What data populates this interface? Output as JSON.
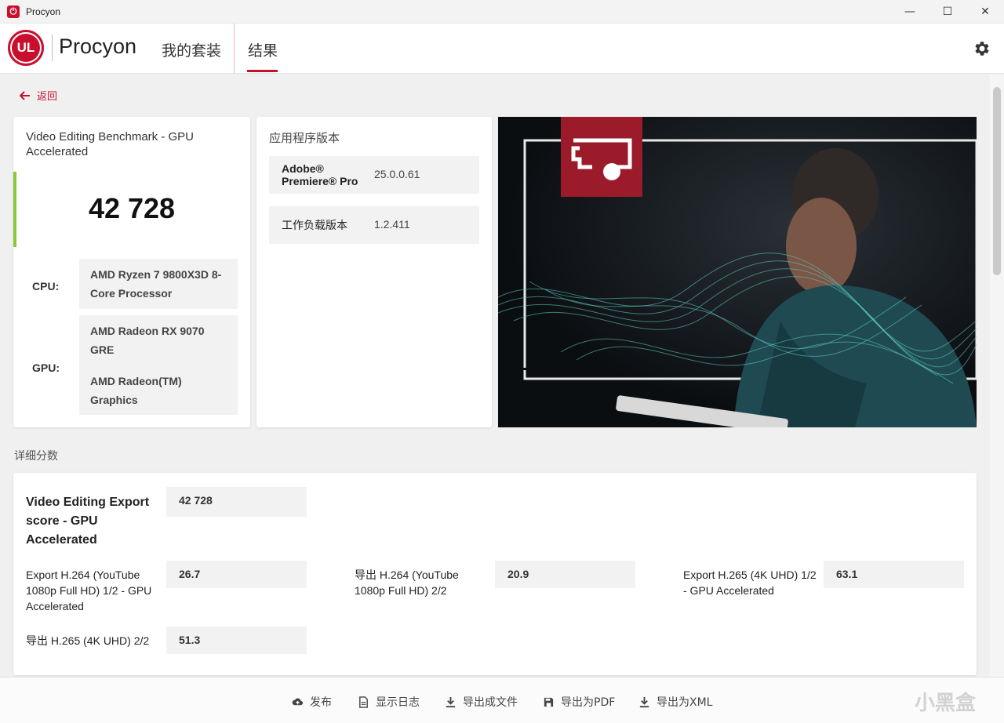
{
  "window": {
    "title": "Procyon",
    "minimize": "—",
    "maximize": "☐",
    "close": "✕"
  },
  "header": {
    "logo_text": "UL",
    "brand": "Procyon",
    "tabs": [
      {
        "label": "我的套装"
      },
      {
        "label": "结果"
      }
    ],
    "active_tab": "结果"
  },
  "nav": {
    "back_label": "返回"
  },
  "summary": {
    "benchmark_title": "Video Editing Benchmark - GPU Accelerated",
    "score": "42 728",
    "cpu_label": "CPU:",
    "cpu_value": "AMD Ryzen 7 9800X3D 8-Core Processor",
    "gpu_label": "GPU:",
    "gpu_values": [
      "AMD Radeon RX 9070 GRE",
      "AMD Radeon(TM) Graphics"
    ],
    "accent_color": "#8cc63f"
  },
  "versions": {
    "title": "应用程序版本",
    "rows": [
      {
        "key": "Adobe® Premiere® Pro",
        "value": "25.0.0.61"
      },
      {
        "key": "工作负载版本",
        "value": "1.2.411"
      }
    ]
  },
  "details": {
    "section_title": "详细分数",
    "main": {
      "label": "Video Editing Export score - GPU Accelerated",
      "value": "42 728"
    },
    "items": [
      {
        "label": "Export H.264 (YouTube 1080p Full HD) 1/2 - GPU Accelerated",
        "value": "26.7"
      },
      {
        "label": "导出 H.264 (YouTube 1080p Full HD) 2/2",
        "value": "20.9"
      },
      {
        "label": "Export H.265 (4K UHD) 1/2 - GPU Accelerated",
        "value": "63.1"
      },
      {
        "label": "导出 H.265 (4K UHD) 2/2",
        "value": "51.3"
      }
    ]
  },
  "footer": {
    "actions": [
      {
        "label": "发布",
        "icon": "cloud-upload-icon"
      },
      {
        "label": "显示日志",
        "icon": "document-icon"
      },
      {
        "label": "导出成文件",
        "icon": "download-icon"
      },
      {
        "label": "导出为PDF",
        "icon": "save-icon"
      },
      {
        "label": "导出为XML",
        "icon": "download-icon"
      }
    ],
    "watermark": "小黑盒"
  },
  "colors": {
    "brand": "#c8102e",
    "background": "#f0f0f0"
  }
}
